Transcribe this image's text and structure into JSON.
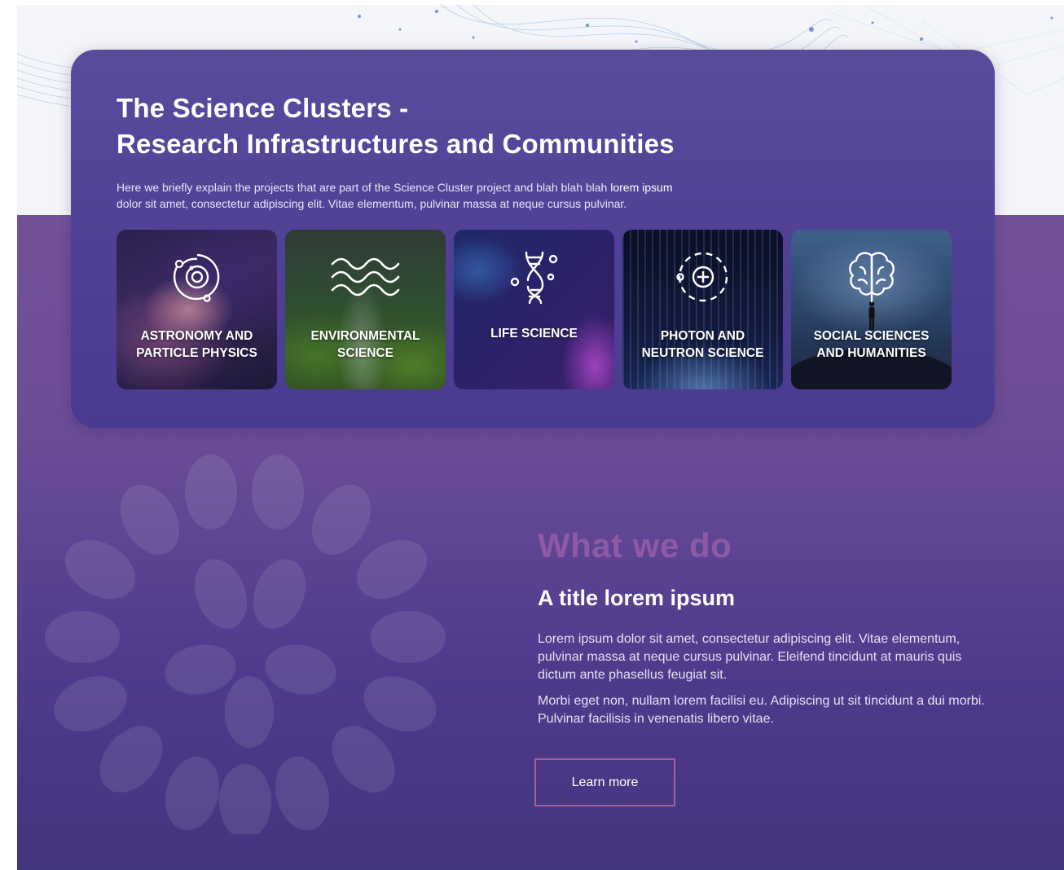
{
  "hero": {
    "title_line1": "The Science Clusters -",
    "title_line2": "Research Infrastructures and Communities",
    "description_plain": "Here we briefly explain the projects that are part of the Science Cluster project and blah blah blah ",
    "description_emph": "lorem ipsum",
    "description_rest": "dolor sit amet, consectetur adipiscing elit. Vitae elementum, pulvinar massa at neque cursus pulvinar."
  },
  "clusters": [
    {
      "label_line1": "Astronomy and",
      "label_line2": "Particle Physics",
      "icon": "orbit-icon"
    },
    {
      "label_line1": "Environmental",
      "label_line2": "Science",
      "icon": "waves-icon"
    },
    {
      "label_line1": "Life Science",
      "label_line2": "",
      "icon": "dna-icon"
    },
    {
      "label_line1": "Photon and",
      "label_line2": "Neutron Science",
      "icon": "atom-circle-icon"
    },
    {
      "label_line1": "Social Sciences",
      "label_line2": "and Humanities",
      "icon": "brain-icon"
    }
  ],
  "what_we_do": {
    "kicker": "What we do",
    "title": "A title lorem ipsum",
    "paragraph1": "Lorem ipsum dolor sit amet, consectetur adipiscing elit. Vitae elementum, pulvinar massa at neque cursus pulvinar. Eleifend tincidunt at mauris quis dictum ante phasellus feugiat sit.",
    "paragraph2": "Morbi eget non, nullam lorem facilisi eu. Adipiscing ut sit tincidunt a dui morbi. Pulvinar facilisis in venenatis libero vitae.",
    "button_label": "Learn more"
  },
  "colors": {
    "card_background": "#584b9c",
    "section_background": "#6b4d97",
    "kicker": "#8d5aa6",
    "button_border": "#a5609f"
  }
}
